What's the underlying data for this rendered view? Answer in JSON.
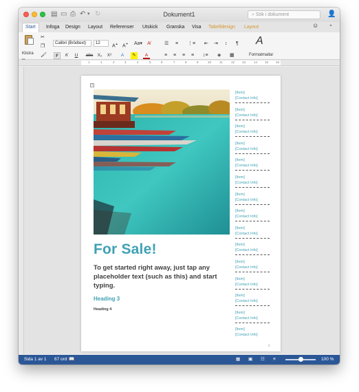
{
  "window": {
    "title": "Dokument1",
    "search_placeholder": "Sök i dokument"
  },
  "tabs": [
    "Start",
    "Infoga",
    "Design",
    "Layout",
    "Referenser",
    "Utskick",
    "Granska",
    "Visa",
    "Tabelldesign",
    "Layout"
  ],
  "ribbon": {
    "paste_label": "Klistra in",
    "font_name": "Calibri (Brödtext)",
    "font_size": "12",
    "styles_label": "Formatmallar",
    "bold": "F",
    "italic": "K",
    "underline": "U",
    "strike": "abc",
    "subscript": "X₂",
    "superscript": "X²"
  },
  "ruler_numbers": [
    "1",
    "1",
    "2",
    "3",
    "4",
    "5",
    "6",
    "7",
    "8",
    "9",
    "10",
    "11",
    "12",
    "13",
    "14",
    "15",
    "16"
  ],
  "document": {
    "title": "For Sale!",
    "intro": "To get started right away, just tap any placeholder text (such as this) and start typing.",
    "heading3": "Heading 3",
    "heading4": "Heading 4",
    "tear_off": [
      {
        "item": "[Item]",
        "contact": "[Contact Info]"
      },
      {
        "item": "[Item]",
        "contact": "[Contact Info]"
      },
      {
        "item": "[Item]",
        "contact": "[Contact Info]"
      },
      {
        "item": "[Item]",
        "contact": "[Contact Info]"
      },
      {
        "item": "[Item]",
        "contact": "[Contact Info]"
      },
      {
        "item": "[Item]",
        "contact": "[Contact Info]"
      },
      {
        "item": "[Item]",
        "contact": "[Contact Info]"
      },
      {
        "item": "[Item]",
        "contact": "[Contact Info]"
      },
      {
        "item": "[Item]",
        "contact": "[Contact Info]"
      },
      {
        "item": "[Item]",
        "contact": "[Contact Info]"
      },
      {
        "item": "[Item]",
        "contact": "[Contact Info]"
      },
      {
        "item": "[Item]",
        "contact": "[Contact Info]"
      },
      {
        "item": "[Item]",
        "contact": "[Contact Info]"
      },
      {
        "item": "[Item]",
        "contact": "[Contact Info]"
      },
      {
        "item": "[Item]",
        "contact": "[Contact Info]"
      }
    ]
  },
  "status": {
    "page": "Sida 1 av 1",
    "words": "67 ord",
    "zoom": "100 %"
  },
  "colors": {
    "accent": "#3fa2b4",
    "status_bar": "#2b5797",
    "context_tab": "#d6952c"
  }
}
